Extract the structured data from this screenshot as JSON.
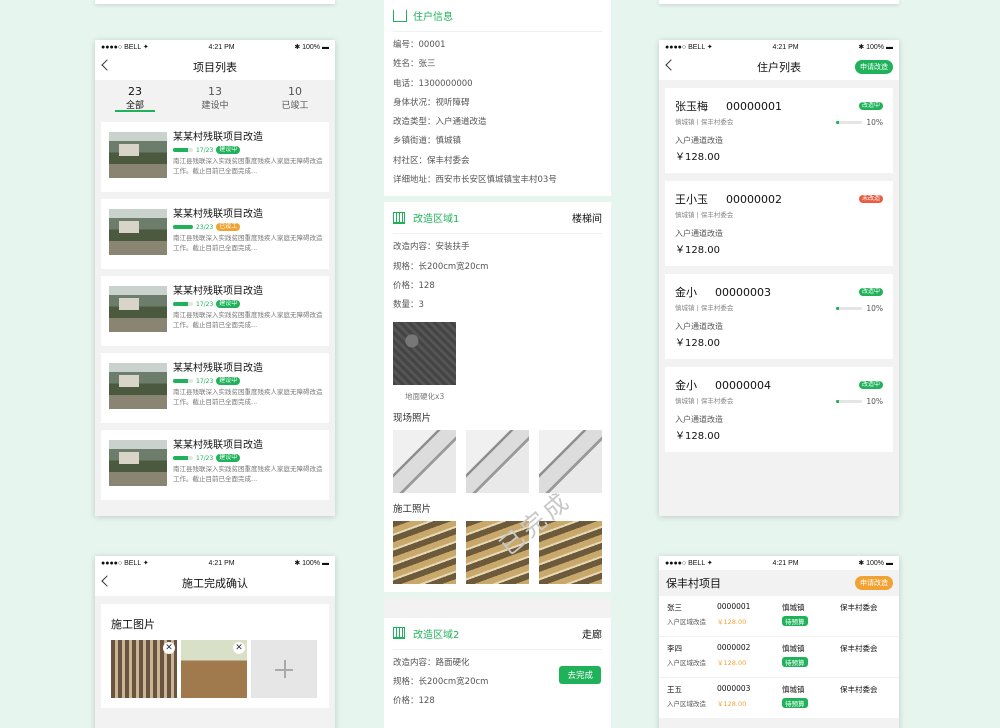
{
  "status": {
    "carrier": "●●●●○ BELL ✦",
    "time": "4:21 PM",
    "battery": "✱ 100% ▬"
  },
  "projects": {
    "title": "项目列表",
    "tabs": [
      {
        "count": "23",
        "label": "全部"
      },
      {
        "count": "13",
        "label": "建设中"
      },
      {
        "count": "10",
        "label": "已竣工"
      }
    ],
    "items": [
      {
        "title": "某某村残联项目改造",
        "progress": "17/23",
        "tag": "建设中",
        "desc": "南江县残联深入实践贫困重度残疾人家庭无障碍改造工作。截止目前已全面完成...",
        "frac": 0.74
      },
      {
        "title": "某某村残联项目改造",
        "progress": "23/23",
        "tag": "已竣工",
        "desc": "南江县残联深入实践贫困重度残疾人家庭无障碍改造工作。截止目前已全面完成...",
        "frac": 1.0
      },
      {
        "title": "某某村残联项目改造",
        "progress": "17/23",
        "tag": "建设中",
        "desc": "南江县残联深入实践贫困重度残疾人家庭无障碍改造工作。截止目前已全面完成...",
        "frac": 0.74
      },
      {
        "title": "某某村残联项目改造",
        "progress": "17/23",
        "tag": "建设中",
        "desc": "南江县残联深入实践贫困重度残疾人家庭无障碍改造工作。截止目前已全面完成...",
        "frac": 0.74
      },
      {
        "title": "某某村残联项目改造",
        "progress": "17/23",
        "tag": "建设中",
        "desc": "南江县残联深入实践贫困重度残疾人家庭无障碍改造工作。截止目前已全面完成...",
        "frac": 0.74
      }
    ]
  },
  "confirm": {
    "title": "施工完成确认",
    "section": "施工图片"
  },
  "detail": {
    "header": "住户信息",
    "rows": [
      "编号：00001",
      "姓名：张三",
      "电话：1300000000",
      "身体状况：视听障碍",
      "改造类型：入户通道改造",
      "乡镇街道：慎城镇",
      "村社区：保丰村委会",
      "详细地址：西安市长安区慎城镇宝丰村03号"
    ],
    "area1": {
      "title": "改造区域1",
      "place": "楼梯间",
      "rows": [
        "改造内容：安装扶手",
        "规格：长200cm宽20cm",
        "价格：128",
        "数量：3"
      ],
      "caption": "地面硬化x3",
      "stamp": "已完成"
    },
    "site_photos": "现场照片",
    "build_photos": "施工照片",
    "area2": {
      "title": "改造区域2",
      "place": "走廊",
      "rows": [
        "改造内容：路面硬化",
        "规格：长200cm宽20cm",
        "价格：128"
      ],
      "button": "去完成"
    }
  },
  "residents": {
    "title": "住户列表",
    "apply": "申请改造",
    "items": [
      {
        "name": "张玉梅",
        "code": "00000001",
        "sub": "慎城镇 | 保丰村委会",
        "type": "入户通道改造",
        "price": "￥128.00",
        "tag": "改造中",
        "pct": "10%",
        "frac": 0.1
      },
      {
        "name": "王小玉",
        "code": "00000002",
        "sub": "慎城镇 | 保丰村委会",
        "type": "入户通道改造",
        "price": "￥128.00",
        "tag": "未改造"
      },
      {
        "name": "金小",
        "code": "00000003",
        "sub": "慎城镇 | 保丰村委会",
        "type": "入户通道改造",
        "price": "￥128.00",
        "tag": "改造中",
        "pct": "10%",
        "frac": 0.1
      },
      {
        "name": "金小",
        "code": "00000004",
        "sub": "慎城镇 | 保丰村委会",
        "type": "入户通道改造",
        "price": "￥128.00",
        "tag": "改造中",
        "pct": "10%",
        "frac": 0.1
      }
    ]
  },
  "baofeng": {
    "title": "保丰村项目",
    "apply": "申请改造",
    "rows": [
      {
        "name": "张三",
        "code": "0000001",
        "town": "慎城镇",
        "village": "保丰村委会",
        "type": "入户区域改造",
        "price": "￥128.00",
        "status": "待预算"
      },
      {
        "name": "李四",
        "code": "0000002",
        "town": "慎城镇",
        "village": "保丰村委会",
        "type": "入户区域改造",
        "price": "￥128.00",
        "status": "待预算"
      },
      {
        "name": "王五",
        "code": "0000003",
        "town": "慎城镇",
        "village": "保丰村委会",
        "type": "入户区域改造",
        "price": "￥128.00",
        "status": "待预算"
      }
    ]
  }
}
